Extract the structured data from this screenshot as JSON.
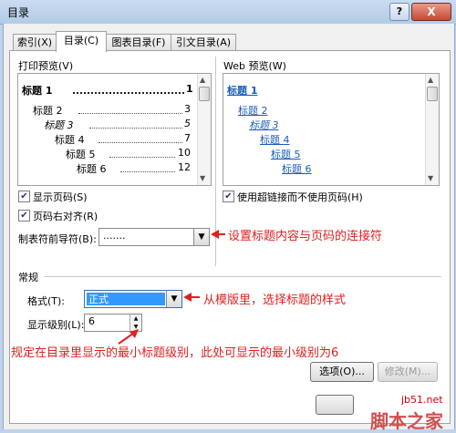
{
  "window": {
    "title": "目录",
    "help": "?",
    "close": "X"
  },
  "tabs": [
    {
      "label": "索引(X)"
    },
    {
      "label": "目录(C)"
    },
    {
      "label": "图表目录(F)"
    },
    {
      "label": "引文目录(A)"
    }
  ],
  "print_preview": {
    "label": "打印预览(V)",
    "lines": [
      {
        "text": "标题 1",
        "page": "1"
      },
      {
        "text": "标题 2",
        "page": "3"
      },
      {
        "text": "标题 3",
        "page": "5"
      },
      {
        "text": "标题 4",
        "page": "7"
      },
      {
        "text": "标题 5",
        "page": "10"
      },
      {
        "text": "标题 6",
        "page": "12"
      }
    ]
  },
  "web_preview": {
    "label": "Web 预览(W)",
    "links": [
      "标题 1",
      "标题 2",
      "标题 3",
      "标题 4",
      "标题 5",
      "标题 6"
    ]
  },
  "options": {
    "show_page_numbers": "显示页码(S)",
    "right_align": "页码右对齐(R)",
    "tab_leader_label": "制表符前导符(B):",
    "tab_leader_value": ".......",
    "use_hyperlinks": "使用超链接而不使用页码(H)"
  },
  "general": {
    "label": "常规",
    "format_label": "格式(T):",
    "format_value": "正式",
    "levels_label": "显示级别(L):",
    "levels_value": "6"
  },
  "buttons": {
    "options": "选项(O)...",
    "modify": "修改(M)..."
  },
  "annotations": {
    "leader": "设置标题内容与页码的连接符",
    "format": "从模版里，选择标题的样式",
    "levels": "规定在目录里显示的最小标题级别，此处可显示的最小级别为6"
  },
  "watermark": {
    "site": "jb51.net",
    "name": "脚本之家"
  }
}
